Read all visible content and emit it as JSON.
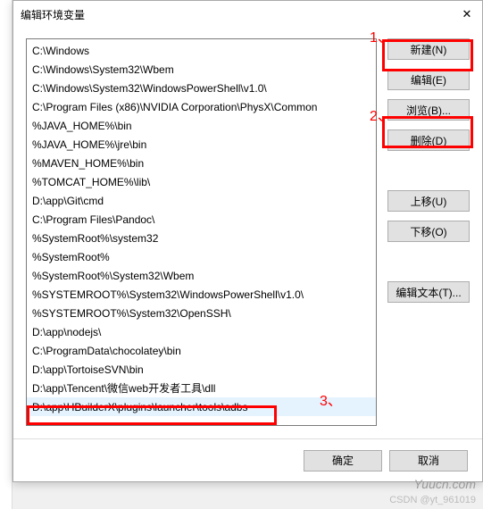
{
  "dialog": {
    "title": "编辑环境变量",
    "close_glyph": "✕"
  },
  "paths": [
    "C:\\Windows",
    "C:\\Windows\\System32\\Wbem",
    "C:\\Windows\\System32\\WindowsPowerShell\\v1.0\\",
    "C:\\Program Files (x86)\\NVIDIA Corporation\\PhysX\\Common",
    "%JAVA_HOME%\\bin",
    "%JAVA_HOME%\\jre\\bin",
    "%MAVEN_HOME%\\bin",
    "%TOMCAT_HOME%\\lib\\",
    "D:\\app\\Git\\cmd",
    "C:\\Program Files\\Pandoc\\",
    "%SystemRoot%\\system32",
    "%SystemRoot%",
    "%SystemRoot%\\System32\\Wbem",
    "%SYSTEMROOT%\\System32\\WindowsPowerShell\\v1.0\\",
    "%SYSTEMROOT%\\System32\\OpenSSH\\",
    "D:\\app\\nodejs\\",
    "C:\\ProgramData\\chocolatey\\bin",
    "D:\\app\\TortoiseSVN\\bin",
    "D:\\app\\Tencent\\微信web开发者工具\\dll",
    "D:\\app\\HBuilderX\\plugins\\launcher\\tools\\adbs"
  ],
  "selected_index": 19,
  "buttons": {
    "new": "新建(N)",
    "edit": "编辑(E)",
    "browse": "浏览(B)...",
    "delete": "删除(D)",
    "up": "上移(U)",
    "down": "下移(O)",
    "edit_text": "编辑文本(T)...",
    "ok": "确定",
    "cancel": "取消"
  },
  "annotations": {
    "a1": "1、",
    "a2": "2、",
    "a3": "3、"
  },
  "watermark": {
    "site": "Yuucn.com",
    "csdn": "CSDN @yt_961019"
  }
}
